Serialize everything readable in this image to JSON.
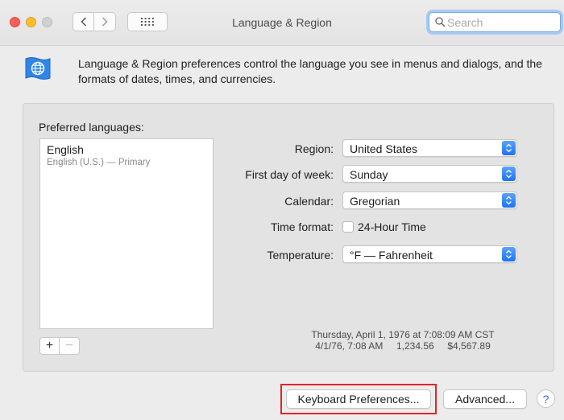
{
  "window": {
    "title": "Language & Region"
  },
  "toolbar": {
    "back_icon": "chevron-left-icon",
    "forward_icon": "chevron-right-icon",
    "grid_icon": "grid-icon",
    "search_placeholder": "Search",
    "search_value": ""
  },
  "header": {
    "icon": "flag-globe-icon",
    "description": "Language & Region preferences control the language you see in menus and dialogs, and the formats of dates, times, and currencies."
  },
  "languages": {
    "label": "Preferred languages:",
    "items": [
      {
        "name": "English",
        "detail": "English (U.S.) — Primary"
      }
    ],
    "add_label": "+",
    "remove_label": "−"
  },
  "settings": {
    "region": {
      "label": "Region:",
      "value": "United States"
    },
    "first_day": {
      "label": "First day of week:",
      "value": "Sunday"
    },
    "calendar": {
      "label": "Calendar:",
      "value": "Gregorian"
    },
    "time_format": {
      "label": "Time format:",
      "checkbox_label": "24-Hour Time",
      "checked": false
    },
    "temperature": {
      "label": "Temperature:",
      "value": "°F — Fahrenheit"
    }
  },
  "sample": {
    "line1": "Thursday, April 1, 1976 at 7:08:09 AM CST",
    "line2": "4/1/76, 7:08 AM     1,234.56     $4,567.89"
  },
  "buttons": {
    "keyboard": "Keyboard Preferences...",
    "advanced": "Advanced...",
    "help": "?"
  },
  "colors": {
    "accent": "#1d73f0",
    "highlight": "#e0242a"
  }
}
